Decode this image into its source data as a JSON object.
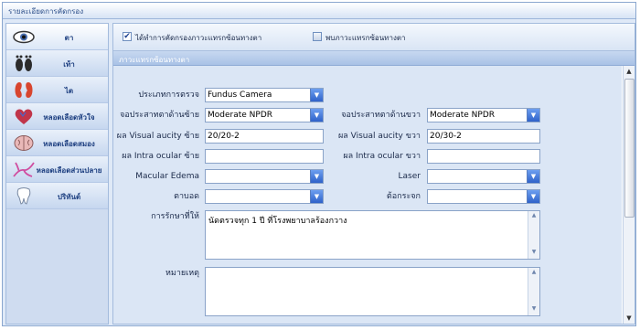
{
  "window": {
    "title": "รายละเอียดการคัดกรอง"
  },
  "sidebar": {
    "items": [
      {
        "label": "ตา",
        "icon": "eye-icon",
        "active": true
      },
      {
        "label": "เท้า",
        "icon": "feet-icon"
      },
      {
        "label": "ไต",
        "icon": "kidney-icon"
      },
      {
        "label": "หลอดเลือดหัวใจ",
        "icon": "heart-icon"
      },
      {
        "label": "หลอดเลือดสมอง",
        "icon": "brain-icon"
      },
      {
        "label": "หลอดเลือดส่วนปลาย",
        "icon": "vessel-icon"
      },
      {
        "label": "ปริทันต์",
        "icon": "tooth-icon"
      }
    ]
  },
  "checks": {
    "screened": {
      "label": "ได้ทำการคัดกรองภาวะแทรกซ้อนทางตา",
      "checked": true
    },
    "found": {
      "label": "พบภาวะแทรกซ้อนทางตา",
      "checked": false
    }
  },
  "section": {
    "title": "ภาวะแทรกซ้อนทางตา"
  },
  "form": {
    "exam_type": {
      "label": "ประเภทการตรวจ",
      "value": "Fundus Camera"
    },
    "retina_left": {
      "label": "จอประสาทตาด้านซ้าย",
      "value": "Moderate NPDR"
    },
    "retina_right": {
      "label": "จอประสาทตาด้านขวา",
      "value": "Moderate NPDR"
    },
    "va_left": {
      "label": "ผล Visual aucity ซ้าย",
      "value": "20/20-2"
    },
    "va_right": {
      "label": "ผล Visual aucity ขวา",
      "value": "20/30-2"
    },
    "iop_left": {
      "label": "ผล Intra ocular ซ้าย",
      "value": ""
    },
    "iop_right": {
      "label": "ผล Intra ocular ขวา",
      "value": ""
    },
    "macular_edema": {
      "label": "Macular Edema",
      "value": ""
    },
    "laser": {
      "label": "Laser",
      "value": ""
    },
    "blindness": {
      "label": "ตาบอด",
      "value": ""
    },
    "cataract": {
      "label": "ต้อกระจก",
      "value": ""
    },
    "treatment": {
      "label": "การรักษาที่ให้",
      "value": "นัดตรวจทุก 1 ปี ที่โรงพยาบาลร้องกวาง"
    },
    "notes": {
      "label": "หมายเหตุ",
      "value": ""
    }
  },
  "colors": {
    "accent": "#2f62c9",
    "panel": "#dbe6f5"
  }
}
